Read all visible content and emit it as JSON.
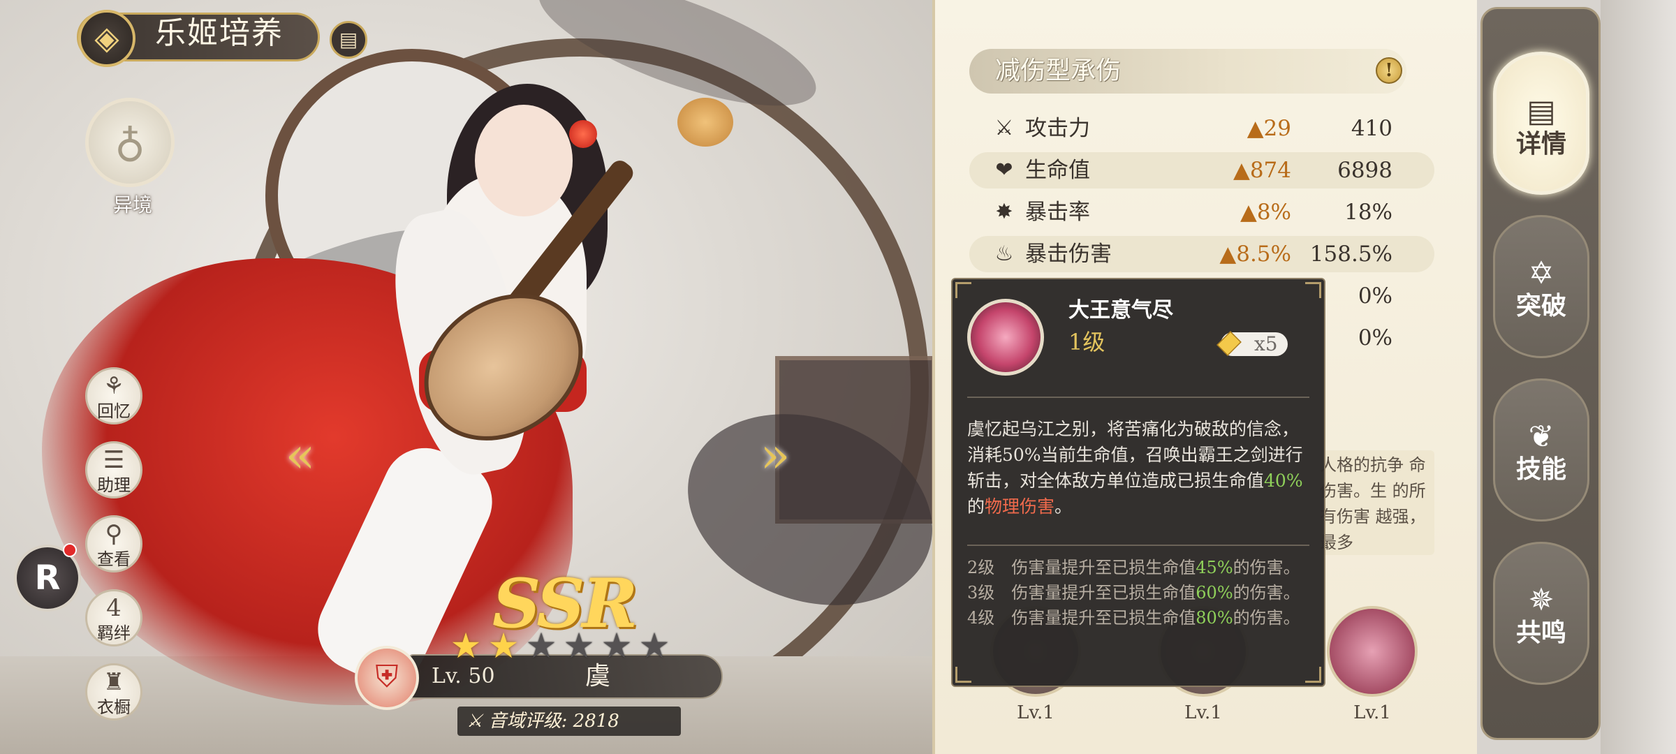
{
  "header": {
    "title": "乐姬培养",
    "back_icon": "back-diamond-icon",
    "notebook_icon": "notebook-icon"
  },
  "left_menu": {
    "otherworld": {
      "label": "异境",
      "icon": "dragon-emblem-icon"
    },
    "buttons": [
      {
        "label": "回忆",
        "icon": "memory-icon",
        "glyph": "⚬"
      },
      {
        "label": "助理",
        "icon": "assistant-icon",
        "glyph": "☰"
      },
      {
        "label": "查看",
        "icon": "magnifier-icon",
        "glyph": "⚲"
      },
      {
        "label": "羁绊",
        "icon": "heart-icon",
        "glyph": "4",
        "badge": "4"
      },
      {
        "label": "衣橱",
        "icon": "dress-icon",
        "glyph": "👘"
      }
    ],
    "r_badge": "R"
  },
  "character": {
    "rarity": "SSR",
    "stars_total": 6,
    "stars_filled": 2,
    "level": "Lv. 50",
    "name": "虞",
    "score": "音域评级: 2818"
  },
  "panel": {
    "section_title": "减伤型承伤",
    "stats": [
      {
        "icon": "sword-icon",
        "glyph": "⚔",
        "name": "攻击力",
        "increase": "29",
        "value": "410"
      },
      {
        "icon": "heart-icon",
        "glyph": "❤",
        "name": "生命值",
        "increase": "874",
        "value": "6898"
      },
      {
        "icon": "burst-icon",
        "glyph": "✸",
        "name": "暴击率",
        "increase": "8%",
        "value": "18%"
      },
      {
        "icon": "crit-damage-icon",
        "glyph": "⛰",
        "name": "暴击伤害",
        "increase": "8.5%",
        "value": "158.5%"
      },
      {
        "value": "0%"
      },
      {
        "value": "0%"
      }
    ],
    "bg_description": "人格的抗争 命伤害。生 的所有伤害 越强，最多",
    "skill_levels": [
      "Lv.1",
      "Lv.1",
      "Lv.1"
    ]
  },
  "tooltip": {
    "skill_name": "大王意气尽",
    "level": "1级",
    "cost": "x5",
    "desc_part1": "虞忆起乌江之别，将苦痛化为破敌的信念，消耗50%当前生命值，召唤出霸王之剑进行斩击，对全体敌方单位造成已损生命值",
    "desc_pct": "40%",
    "desc_part2": "的",
    "desc_type": "物理伤害",
    "desc_end": "。",
    "upgrades": [
      {
        "lv": "2级",
        "text_a": "伤害量提升至已损生命值",
        "pct": "45%",
        "text_b": "的伤害。"
      },
      {
        "lv": "3级",
        "text_a": "伤害量提升至已损生命值",
        "pct": "60%",
        "text_b": "的伤害。"
      },
      {
        "lv": "4级",
        "text_a": "伤害量提升至已损生命值",
        "pct": "80%",
        "text_b": "的伤害。"
      }
    ]
  },
  "tabs": [
    {
      "label": "详情",
      "icon": "details-icon",
      "glyph": "▤",
      "active": true
    },
    {
      "label": "突破",
      "icon": "breakthrough-icon",
      "glyph": "✡",
      "active": false
    },
    {
      "label": "技能",
      "icon": "skill-icon",
      "glyph": "❦",
      "active": false
    },
    {
      "label": "共鸣",
      "icon": "resonance-icon",
      "glyph": "✵",
      "active": false
    }
  ],
  "colors": {
    "accent_gold": "#d7b769",
    "stat_increase": "#b86c1a",
    "tooltip_bg": "#2c2928",
    "highlight_green": "#8fd05a",
    "highlight_red": "#f06a4c"
  }
}
